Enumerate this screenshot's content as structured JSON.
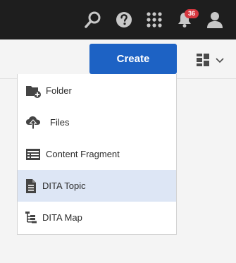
{
  "header": {
    "notifications_count": "36",
    "icons": [
      "search-icon",
      "help-icon",
      "apps-grid-icon",
      "bell-icon",
      "user-icon"
    ]
  },
  "toolbar": {
    "create_label": "Create",
    "view_toggle_icon": "card-view-icon"
  },
  "create_menu": {
    "items": [
      {
        "label": "Folder",
        "icon": "folder-add-icon"
      },
      {
        "label": "Files",
        "icon": "upload-icon"
      },
      {
        "label": "Content Fragment",
        "icon": "content-fragment-icon"
      },
      {
        "label": "DITA Topic",
        "icon": "dita-topic-icon",
        "selected": true
      },
      {
        "label": "DITA Map",
        "icon": "dita-map-icon"
      }
    ]
  },
  "colors": {
    "header_bg": "#1e1e1e",
    "primary_button": "#1d62c4",
    "selected_item_bg": "#dde6f5",
    "badge": "#d7373f"
  }
}
